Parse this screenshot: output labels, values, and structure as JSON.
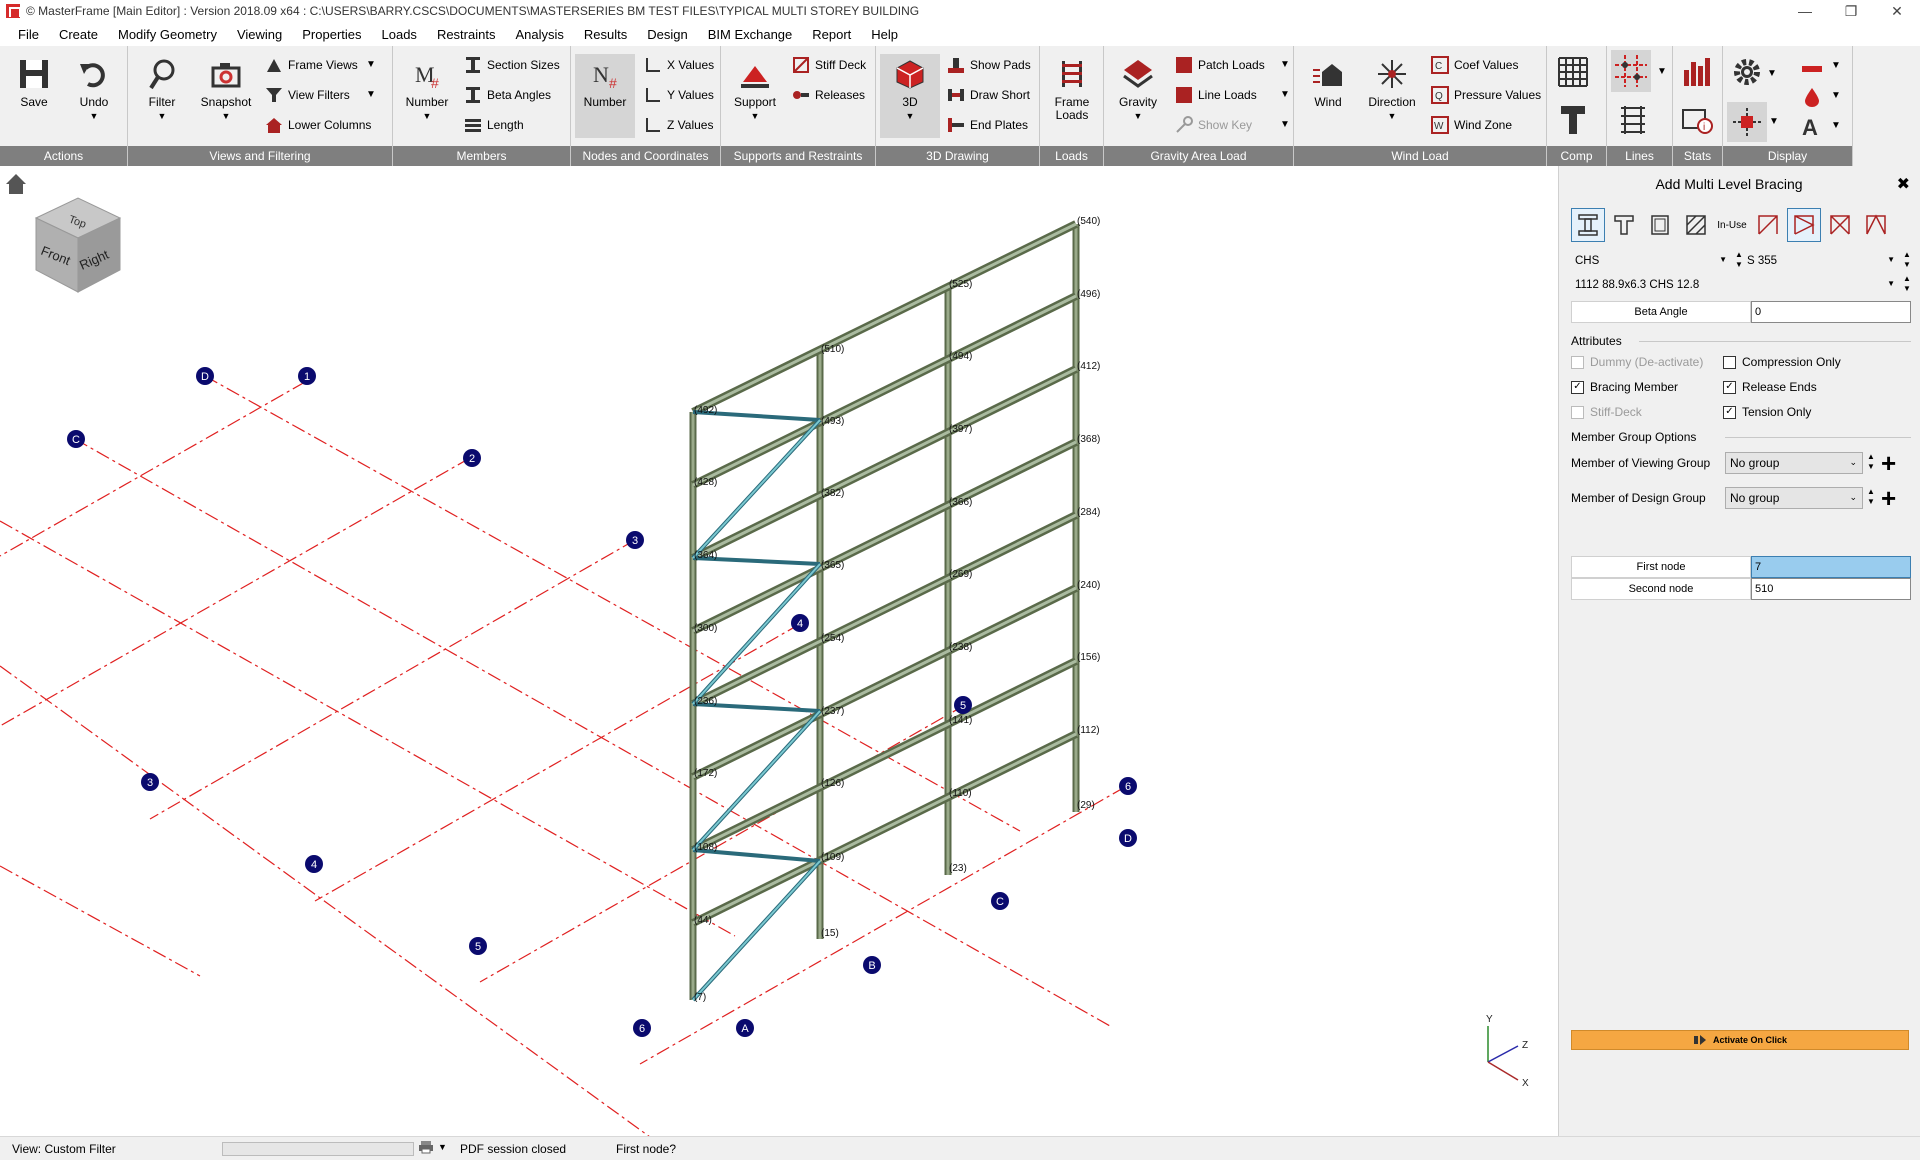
{
  "window": {
    "title": "© MasterFrame [Main Editor] : Version 2018.09 x64 : C:\\USERS\\BARRY.CSCS\\DOCUMENTS\\MASTERSERIES BM TEST FILES\\TYPICAL MULTI STOREY BUILDING"
  },
  "menu": [
    "File",
    "Create",
    "Modify Geometry",
    "Viewing",
    "Properties",
    "Loads",
    "Restraints",
    "Analysis",
    "Results",
    "Design",
    "BIM Exchange",
    "Report",
    "Help"
  ],
  "ribbon": {
    "actions": {
      "group": "Actions",
      "save": "Save",
      "undo": "Undo"
    },
    "views": {
      "group": "Views and Filtering",
      "filter": "Filter",
      "snapshot": "Snapshot",
      "frame_views": "Frame Views",
      "view_filters": "View Filters",
      "lower_columns": "Lower Columns"
    },
    "members": {
      "group": "Members",
      "number": "Number",
      "number_icon": "M",
      "section_sizes": "Section Sizes",
      "beta_angles": "Beta Angles",
      "length": "Length"
    },
    "nodes": {
      "group": "Nodes and Coordinates",
      "number": "Number",
      "number_icon": "N",
      "x_values": "X Values",
      "y_values": "Y Values",
      "z_values": "Z Values"
    },
    "supports": {
      "group": "Supports and Restraints",
      "support": "Support",
      "stiff_deck": "Stiff Deck",
      "releases": "Releases"
    },
    "drawing3d": {
      "group": "3D Drawing",
      "btn3d": "3D",
      "show_pads": "Show Pads",
      "draw_short": "Draw Short",
      "end_plates": "End Plates"
    },
    "loads": {
      "group": "Loads",
      "frame_loads": "Frame Loads"
    },
    "gravity": {
      "group": "Gravity Area Load",
      "gravity": "Gravity",
      "patch_loads": "Patch Loads",
      "line_loads": "Line Loads",
      "show_key": "Show Key"
    },
    "wind": {
      "group": "Wind Load",
      "wind": "Wind",
      "direction": "Direction",
      "coef_values": "Coef Values",
      "pressure_values": "Pressure Values",
      "wind_zone": "Wind Zone"
    },
    "comp": {
      "group": "Comp"
    },
    "lines": {
      "group": "Lines"
    },
    "stats": {
      "group": "Stats"
    },
    "display": {
      "group": "Display"
    }
  },
  "viewcube": {
    "top": "Top",
    "front": "Front",
    "right": "Right"
  },
  "grid_bubbles": [
    {
      "label": "D"
    },
    {
      "label": "1"
    },
    {
      "label": "C"
    },
    {
      "label": "2"
    },
    {
      "label": "3"
    },
    {
      "label": "4"
    },
    {
      "label": "3"
    },
    {
      "label": "4"
    },
    {
      "label": "5"
    },
    {
      "label": "5"
    },
    {
      "label": "6"
    },
    {
      "label": "A"
    },
    {
      "label": "B"
    },
    {
      "label": "C"
    },
    {
      "label": "D"
    },
    {
      "label": "6"
    }
  ],
  "node_labels": [
    "(540)",
    "(525)",
    "(496)",
    "(510)",
    "(494)",
    "(412)",
    "(492)",
    "(493)",
    "(397)",
    "(368)",
    "(428)",
    "(382)",
    "(366)",
    "(284)",
    "(364)",
    "(365)",
    "(269)",
    "(240)",
    "(300)",
    "(254)",
    "(238)",
    "(156)",
    "(236)",
    "(237)",
    "(141)",
    "(112)",
    "(172)",
    "(126)",
    "(110)",
    "(29)",
    "(108)",
    "(109)",
    "(23)",
    "(44)",
    "(15)",
    "(7)"
  ],
  "axes": {
    "y": "Y",
    "z": "Z",
    "x": "X"
  },
  "panel": {
    "title": "Add Multi Level Bracing",
    "in_use": "In-Use",
    "section_type": "CHS",
    "grade": "S 355",
    "section": "1112 88.9x6.3 CHS 12.8",
    "beta_angle_label": "Beta Angle",
    "beta_angle_value": "0",
    "attributes_label": "Attributes",
    "attributes": [
      {
        "label": "Dummy (De-activate)",
        "checked": false,
        "enabled": false
      },
      {
        "label": "Compression Only",
        "checked": false,
        "enabled": true
      },
      {
        "label": "Bracing Member",
        "checked": true,
        "enabled": true
      },
      {
        "label": "Release Ends",
        "checked": true,
        "enabled": true
      },
      {
        "label": "Stiff-Deck",
        "checked": false,
        "enabled": false
      },
      {
        "label": "Tension Only",
        "checked": true,
        "enabled": true
      }
    ],
    "group_options_label": "Member Group Options",
    "viewing_group_label": "Member of Viewing Group",
    "viewing_group_value": "No group",
    "design_group_label": "Member of Design Group",
    "design_group_value": "No group",
    "first_node_label": "First node",
    "first_node_value": "7",
    "second_node_label": "Second node",
    "second_node_value": "510",
    "activate_label": "Activate On Click"
  },
  "status": {
    "view": "View: Custom Filter",
    "pdf": "PDF session closed",
    "prompt": "First node?"
  },
  "colors": {
    "ribbon_label": "#7f7f7f",
    "grid_line": "#e02020",
    "bubble": "#0a0a6e",
    "member": "#7a8a6a",
    "brace": "#4aa0b0",
    "activate": "#f5a742"
  }
}
